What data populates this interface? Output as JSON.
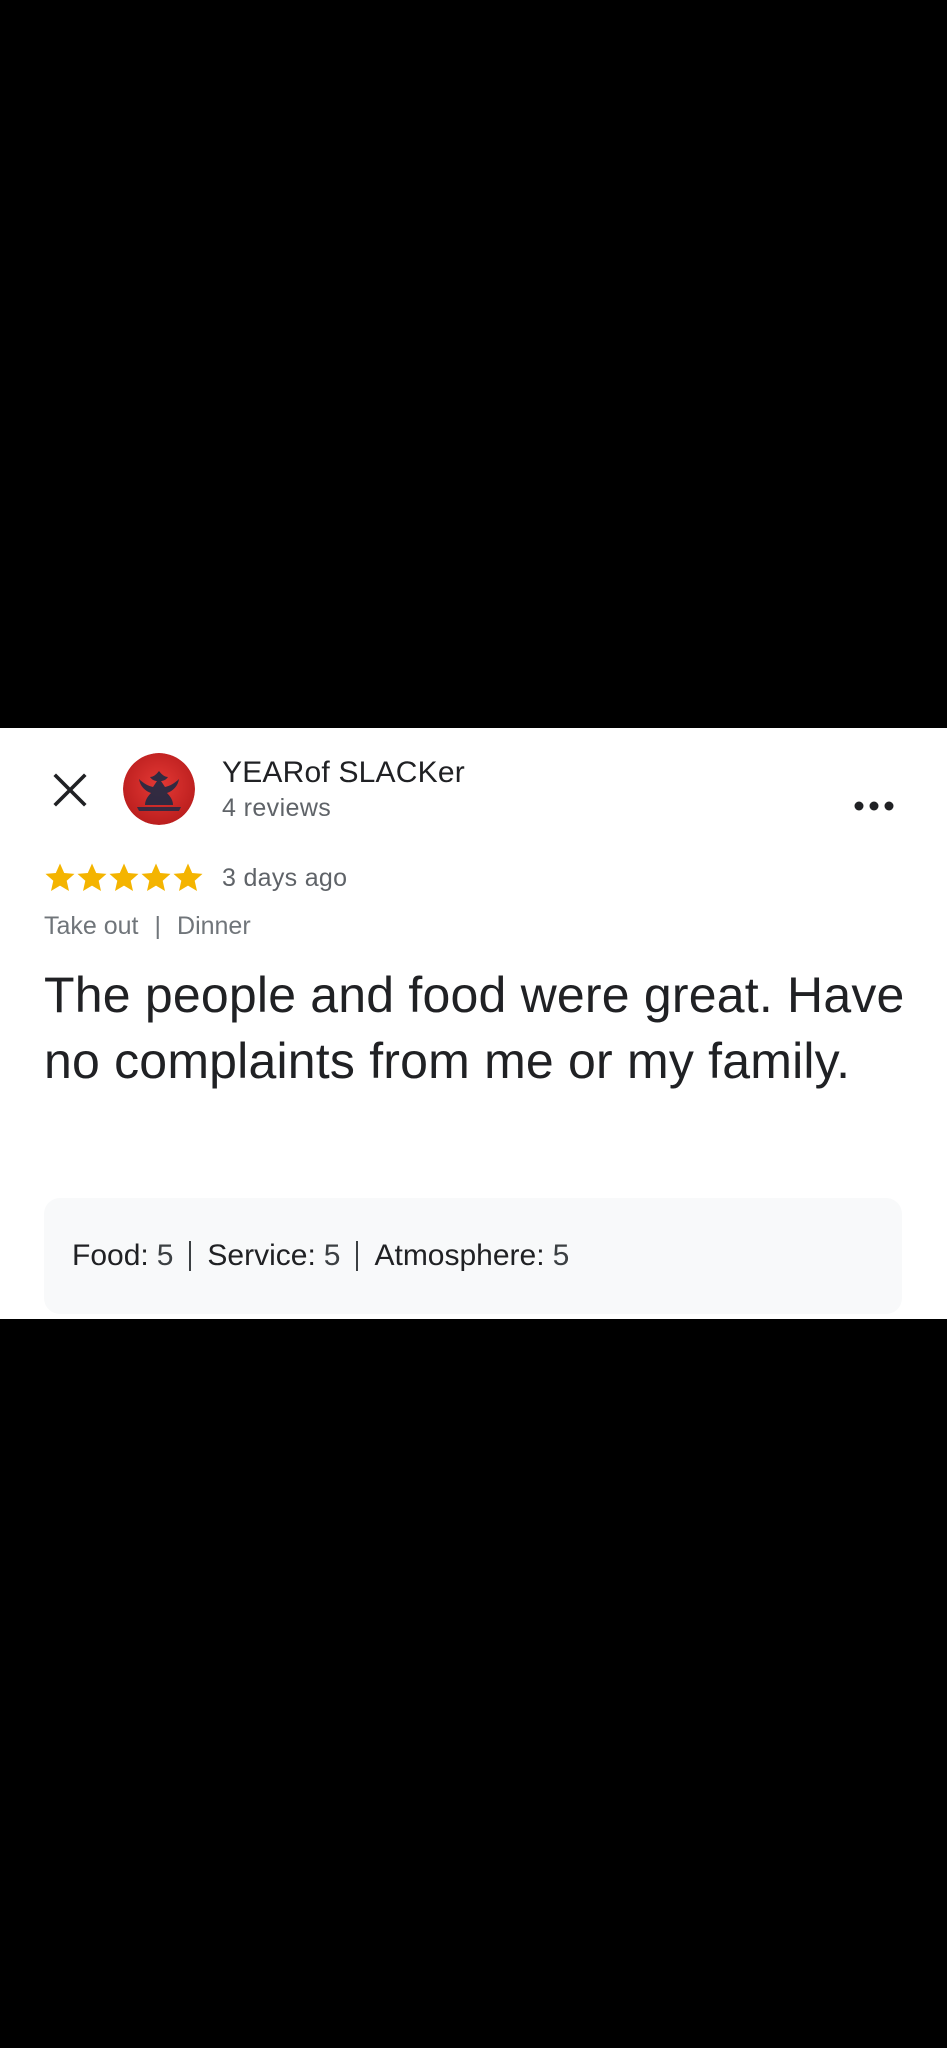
{
  "reviewer": {
    "name": "YEARof SLACKer",
    "reviews_count": "4 reviews"
  },
  "review": {
    "rating": 5,
    "max_rating": 5,
    "time_ago": "3 days ago",
    "tags": [
      "Take out",
      "Dinner"
    ],
    "text": "The people and food were great. Have no complaints from me or my family."
  },
  "sub_ratings": [
    {
      "label": "Food:",
      "value": "5"
    },
    {
      "label": "Service:",
      "value": "5"
    },
    {
      "label": "Atmosphere:",
      "value": "5"
    }
  ],
  "icons": {
    "close": "close-icon",
    "more": "more-horizontal-icon",
    "star": "star-icon"
  },
  "colors": {
    "star": "#F4B400",
    "avatar_red": "#D32F2F",
    "avatar_emblem": "#1F2A44",
    "text_primary": "#202124",
    "text_secondary": "#5f6368",
    "box_bg": "#f8f9fa"
  }
}
